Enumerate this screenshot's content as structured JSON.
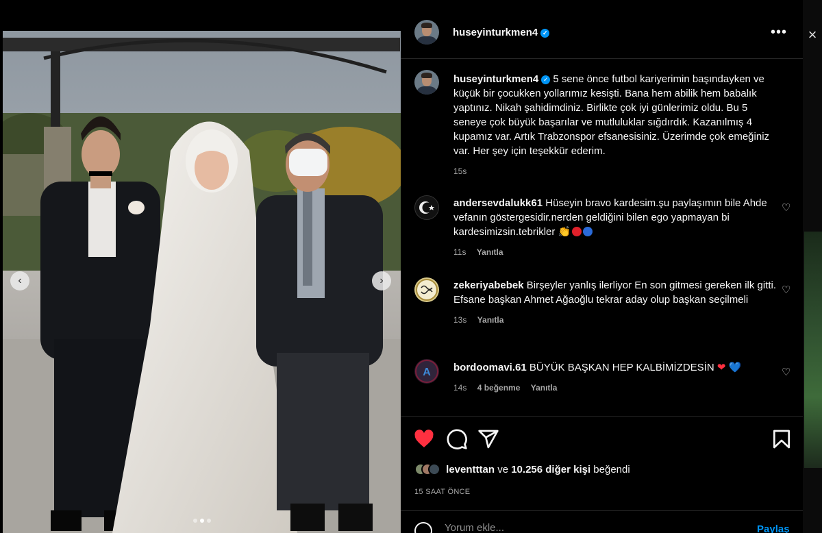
{
  "close_icon": "×",
  "post": {
    "username": "huseyinturkmen4",
    "verified_icon": "✓",
    "more_icon": "•••",
    "caption": "5 sene önce futbol kariyerimin başındayken ve küçük bir çocukken yollarımız kesişti. Bana hem abilik hem babalık yaptınız. Nikah şahidimdiniz. Birlikte çok iyi günlerimiz oldu. Bu 5 seneye çok büyük başarılar ve mutluluklar sığdırdık. Kazanılmış 4 kupamız var. Artık Trabzonspor efsanesisiniz. Üzerimde çok emeğiniz var. Her şey için teşekkür ederim.",
    "caption_time": "15s"
  },
  "carousel": {
    "prev_icon": "‹",
    "next_icon": "›",
    "dots": 3,
    "active_dot": 2
  },
  "comments": [
    {
      "username": "andersevdalukk61",
      "text": "Hüseyin bravo kardesim.şu paylaşımın bile Ahde vefanın göstergesidir.nerden geldiğini bilen ego yapmayan bi kardesimizsin.tebrikler",
      "emojis": [
        "👏"
      ],
      "time": "11s",
      "reply": "Yanıtla"
    },
    {
      "username": "zekeriyabebek",
      "text": "Birşeyler yanlış ilerliyor En son gitmesi gereken ilk gitti. Efsane başkan Ahmet Ağaoğlu tekrar aday olup başkan seçilmeli",
      "time": "13s",
      "reply": "Yanıtla"
    },
    {
      "username": "bordoomavi.61",
      "text": "BÜYÜK BAŞKAN HEP KALBİMİZDESİN",
      "emojis": [
        "❤",
        "💙"
      ],
      "time": "14s",
      "likes": "4 beğenme",
      "reply": "Yanıtla"
    }
  ],
  "likes": {
    "user": "leventttan",
    "connector": "ve",
    "others": "10.256 diğer kişi",
    "suffix": "beğendi"
  },
  "timestamp": "15 SAAT ÖNCE",
  "add_comment": {
    "placeholder": "Yorum ekle...",
    "post_label": "Paylaş"
  },
  "colors": {
    "like_red": "#ff3040",
    "link_blue": "#0095f6",
    "emoji_red": "#e0202a",
    "emoji_blue": "#2a6ad8"
  }
}
